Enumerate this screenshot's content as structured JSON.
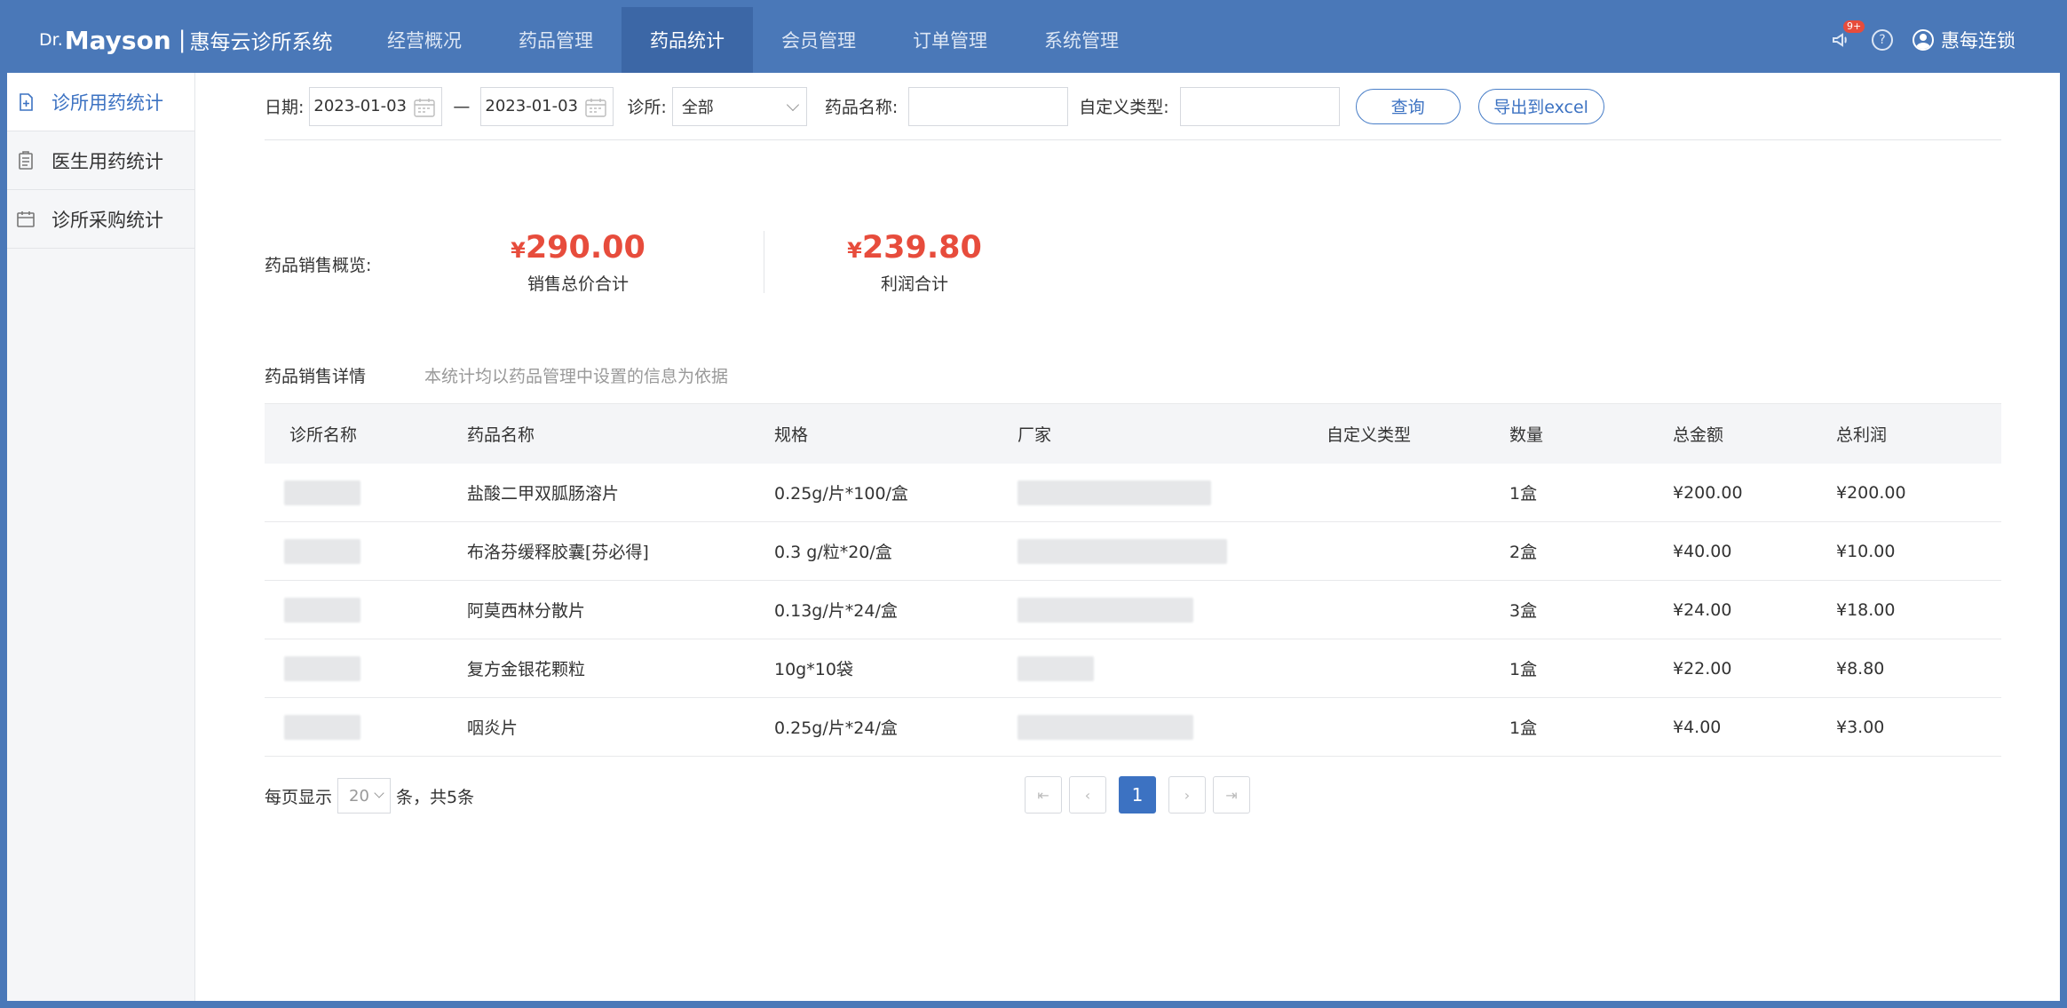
{
  "brand": {
    "dr": "Dr.",
    "mayson": "Mayson",
    "separator": "|",
    "system_name": "惠每云诊所系统"
  },
  "nav": {
    "items": [
      "经营概况",
      "药品管理",
      "药品统计",
      "会员管理",
      "订单管理",
      "系统管理"
    ],
    "active_index": 2
  },
  "header": {
    "notification_badge": "9+",
    "help_label": "?",
    "user_name": "惠每连锁"
  },
  "sidebar": {
    "items": [
      {
        "label": "诊所用药统计",
        "icon": "document-plus-icon",
        "active": true
      },
      {
        "label": "医生用药统计",
        "icon": "clipboard-icon",
        "active": false
      },
      {
        "label": "诊所采购统计",
        "icon": "calendar-box-icon",
        "active": false
      }
    ]
  },
  "filters": {
    "date_label": "日期:",
    "start_date": "2023-01-03",
    "date_separator": "—",
    "end_date": "2023-01-03",
    "clinic_label": "诊所:",
    "clinic_value": "全部",
    "drug_name_label": "药品名称:",
    "drug_name_value": "",
    "custom_type_label": "自定义类型:",
    "custom_type_value": "",
    "query_button": "查询",
    "export_button": "导出到excel"
  },
  "summary": {
    "label": "药品销售概览:",
    "currency": "¥",
    "total_sales": "290.00",
    "total_sales_caption": "销售总价合计",
    "total_profit": "239.80",
    "total_profit_caption": "利润合计"
  },
  "details": {
    "title": "药品销售详情",
    "note": "本统计均以药品管理中设置的信息为依据",
    "columns": [
      "诊所名称",
      "药品名称",
      "规格",
      "厂家",
      "自定义类型",
      "数量",
      "总金额",
      "总利润"
    ],
    "rows": [
      {
        "drug": "盐酸二甲双胍肠溶片",
        "spec": "0.25g/片*100/盒",
        "custom": "",
        "qty": "1盒",
        "amount": "¥200.00",
        "profit": "¥200.00"
      },
      {
        "drug": "布洛芬缓释胶囊[芬必得]",
        "spec": "0.3 g/粒*20/盒",
        "custom": "",
        "qty": "2盒",
        "amount": "¥40.00",
        "profit": "¥10.00"
      },
      {
        "drug": "阿莫西林分散片",
        "spec": "0.13g/片*24/盒",
        "custom": "",
        "qty": "3盒",
        "amount": "¥24.00",
        "profit": "¥18.00"
      },
      {
        "drug": "复方金银花颗粒",
        "spec": "10g*10袋",
        "custom": "",
        "qty": "1盒",
        "amount": "¥22.00",
        "profit": "¥8.80"
      },
      {
        "drug": "咽炎片",
        "spec": "0.25g/片*24/盒",
        "custom": "",
        "qty": "1盒",
        "amount": "¥4.00",
        "profit": "¥3.00"
      }
    ]
  },
  "pagination": {
    "per_page_label": "每页显示",
    "per_page_value": "20",
    "total_text": "条，共5条",
    "current_page": "1",
    "first": "⇤",
    "prev": "‹",
    "next": "›",
    "last": "⇥"
  }
}
